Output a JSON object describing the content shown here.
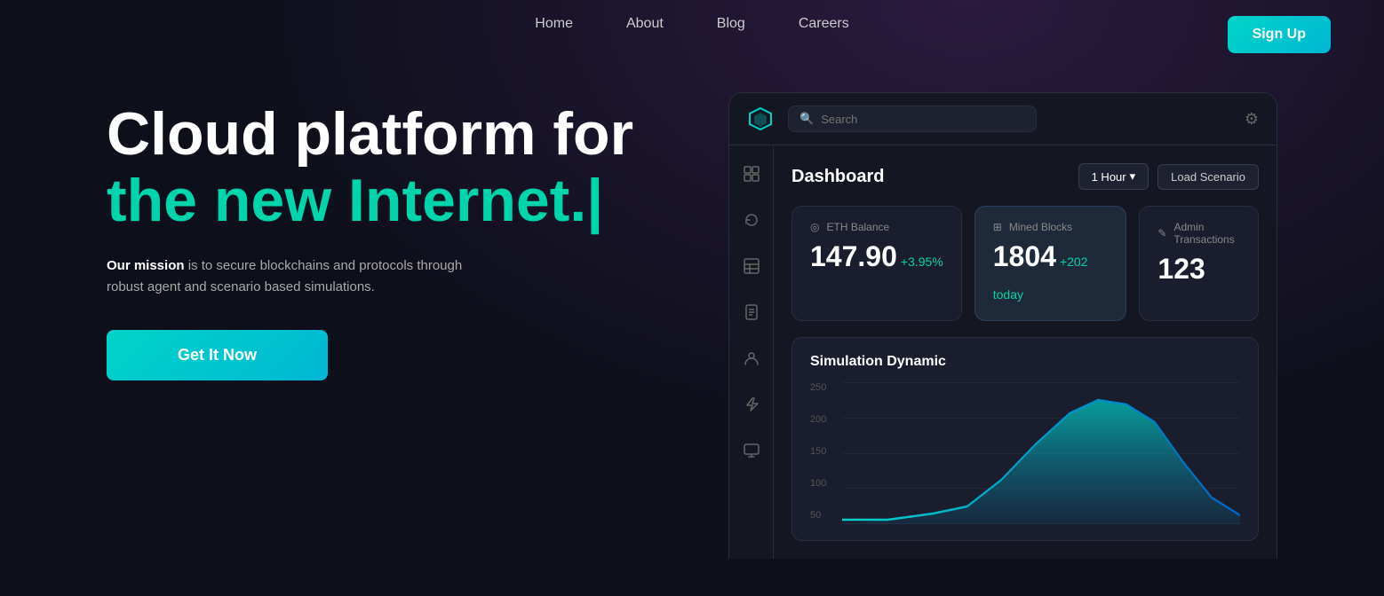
{
  "nav": {
    "links": [
      {
        "label": "Home",
        "id": "home"
      },
      {
        "label": "About",
        "id": "about"
      },
      {
        "label": "Blog",
        "id": "blog"
      },
      {
        "label": "Careers",
        "id": "careers"
      }
    ],
    "signup_label": "Sign Up"
  },
  "hero": {
    "title_line1": "Cloud platform for",
    "title_line2": "the new Internet.|",
    "subtitle_bold": "Our mission",
    "subtitle_rest": " is to secure blockchains and protocols through robust agent and scenario based simulations.",
    "cta_label": "Get It Now"
  },
  "dashboard": {
    "title": "Dashboard",
    "search_placeholder": "Search",
    "controls": {
      "hour_label": "1 Hour",
      "load_scenario_label": "Load Scenario"
    },
    "stats": {
      "eth": {
        "label": "ETH Balance",
        "value": "147.90",
        "change": "+3.95%"
      },
      "mined": {
        "label": "Mined Blocks",
        "value": "1804",
        "change": "+202 today"
      },
      "admin": {
        "label": "Admin Transactions",
        "value": "123"
      }
    },
    "simulation": {
      "title": "Simulation Dynamic",
      "y_labels": [
        "250",
        "200",
        "150",
        "100",
        "50"
      ],
      "chart": {
        "color_start": "#00d4c8",
        "color_end": "#0099cc"
      }
    }
  },
  "sidebar": {
    "icons": [
      "⊞",
      "↩",
      "▦",
      "◱",
      "✦",
      "⚡",
      "▣"
    ]
  },
  "icons": {
    "search": "🔍",
    "gear": "⚙",
    "logo": "◈",
    "eth": "◎",
    "blocks": "⊞",
    "admin": "✎",
    "chevron": "▾"
  }
}
